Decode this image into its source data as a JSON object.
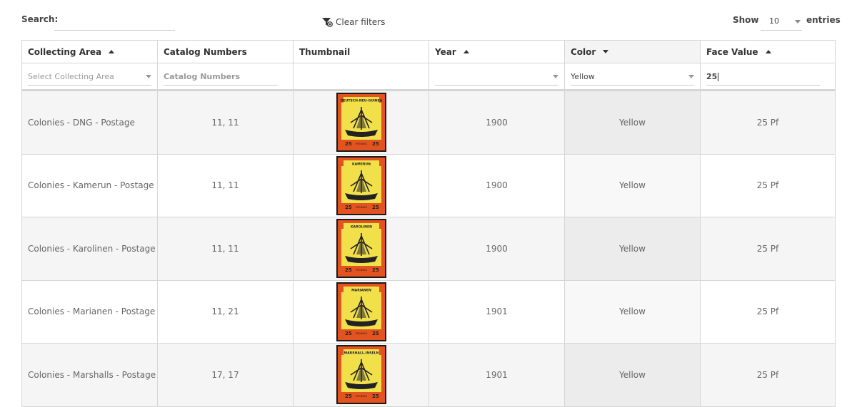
{
  "toolbar": {
    "search_label": "Search:",
    "search_value": "",
    "clear_filters_label": "Clear filters",
    "show_label": "Show",
    "show_value": "10",
    "entries_label": "entries"
  },
  "columns": [
    {
      "label": "Collecting Area",
      "sort": "asc"
    },
    {
      "label": "Catalog Numbers",
      "sort": ""
    },
    {
      "label": "Thumbnail",
      "sort": ""
    },
    {
      "label": "Year",
      "sort": "asc"
    },
    {
      "label": "Color",
      "sort": "desc"
    },
    {
      "label": "Face Value",
      "sort": "asc"
    }
  ],
  "filters": {
    "collecting_area_placeholder": "Select Collecting Area",
    "catalog_numbers_placeholder": "Catalog Numbers",
    "year_value": "",
    "color_value": "Yellow",
    "face_value": "25"
  },
  "rows": [
    {
      "area": "Colonies - DNG - Postage",
      "catalog": "11, 11",
      "stamp_text": "DEUTSCH-NEU-GUINEA",
      "year": "1900",
      "color": "Yellow",
      "face": "25 Pf"
    },
    {
      "area": "Colonies - Kamerun - Postage",
      "catalog": "11, 11",
      "stamp_text": "KAMERUN",
      "year": "1900",
      "color": "Yellow",
      "face": "25 Pf"
    },
    {
      "area": "Colonies - Karolinen - Postage",
      "catalog": "11, 11",
      "stamp_text": "KAROLINEN",
      "year": "1900",
      "color": "Yellow",
      "face": "25 Pf"
    },
    {
      "area": "Colonies - Marianen - Postage",
      "catalog": "11, 21",
      "stamp_text": "MARIANEN",
      "year": "1901",
      "color": "Yellow",
      "face": "25 Pf"
    },
    {
      "area": "Colonies - Marshalls - Postage",
      "catalog": "17, 17",
      "stamp_text": "MARSHALL-INSELN",
      "year": "1901",
      "color": "Yellow",
      "face": "25 Pf"
    }
  ],
  "stamp": {
    "value_text": "25",
    "unit_text": "PFENNIG",
    "frame_color": "#e2531f",
    "field_color": "#f2e04a"
  }
}
